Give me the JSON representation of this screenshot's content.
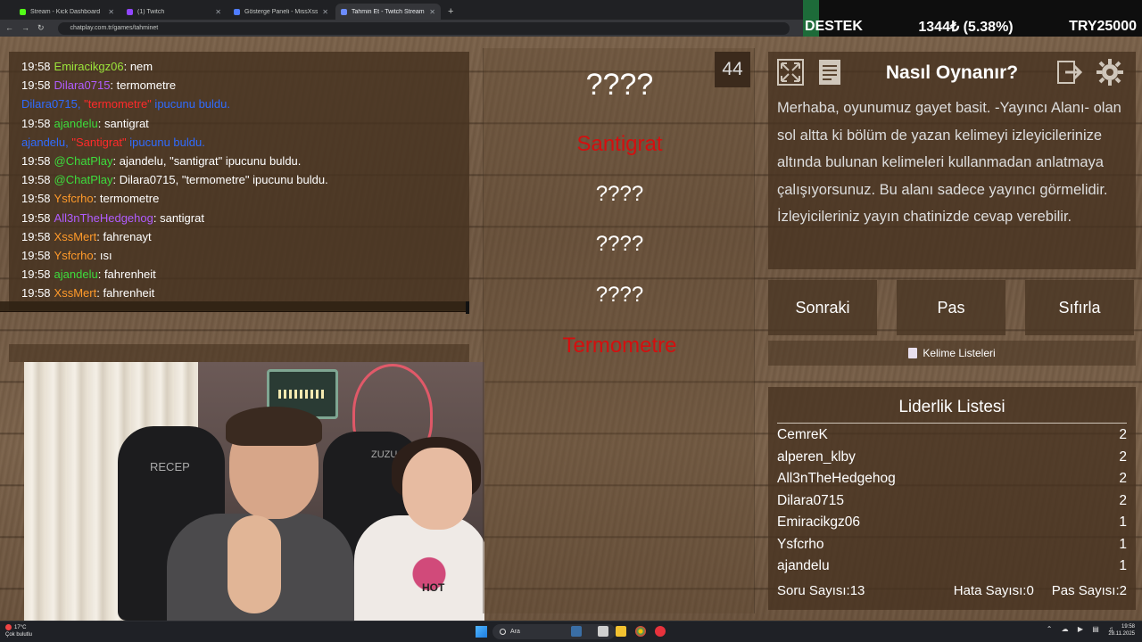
{
  "browser": {
    "tabs": [
      {
        "title": "Stream - Kick Dashboard",
        "color": "#53fc18",
        "active": false
      },
      {
        "title": "(1) Twitch",
        "color": "#9146ff",
        "active": false
      },
      {
        "title": "Gösterge Paneli - MissXss AI Bot",
        "color": "#4f7cff",
        "active": false
      },
      {
        "title": "Tahmin Et - Twitch Stream Game",
        "color": "#6c8cff",
        "active": true
      }
    ],
    "url": "chatplay.com.tr/games/tahminet"
  },
  "ticker": {
    "symbol": "DESTEK",
    "value": "1344₺ (5.38%)",
    "goal": "TRY25000"
  },
  "chat": {
    "lines": [
      {
        "time": "19:58",
        "user": "Emiracikgz06",
        "user_color": "#9be43b",
        "sep": ": ",
        "msg": "nem",
        "msg_color": "#ffffff",
        "system": false
      },
      {
        "time": "19:58",
        "user": "Dilara0715",
        "user_color": "#b05cff",
        "sep": ": ",
        "msg": "termometre",
        "msg_color": "#ffffff",
        "system": false
      },
      {
        "time": "",
        "user": "Dilara0715, ",
        "user_color": "#2f6bff",
        "sep": "",
        "msg": "\"termometre\"",
        "msg_color": "#ff2a2a",
        "tail": " ipucunu buldu.",
        "system": true
      },
      {
        "time": "19:58",
        "user": "ajandelu",
        "user_color": "#3ddc3d",
        "sep": ": ",
        "msg": "santigrat",
        "msg_color": "#ffffff",
        "system": false
      },
      {
        "time": "",
        "user": "ajandelu, ",
        "user_color": "#2f6bff",
        "sep": "",
        "msg": "\"Santigrat\"",
        "msg_color": "#ff2a2a",
        "tail": " ipucunu buldu.",
        "system": true
      },
      {
        "time": "19:58",
        "user": "@ChatPlay",
        "user_color": "#3ddc3d",
        "sep": ": ",
        "msg": "ajandelu, \"santigrat\" ipucunu buldu.",
        "msg_color": "#ffffff",
        "system": false
      },
      {
        "time": "19:58",
        "user": "@ChatPlay",
        "user_color": "#3ddc3d",
        "sep": ": ",
        "msg": "Dilara0715, \"termometre\" ipucunu buldu.",
        "msg_color": "#ffffff",
        "system": false
      },
      {
        "time": "19:58",
        "user": "Ysfcrho",
        "user_color": "#ff9a2a",
        "sep": ": ",
        "msg": "termometre",
        "msg_color": "#ffffff",
        "system": false
      },
      {
        "time": "19:58",
        "user": "All3nTheHedgehog",
        "user_color": "#b05cff",
        "sep": ": ",
        "msg": "santigrat",
        "msg_color": "#ffffff",
        "system": false
      },
      {
        "time": "19:58",
        "user": "XssMert",
        "user_color": "#ff9a2a",
        "sep": ": ",
        "msg": "fahrenayt",
        "msg_color": "#ffffff",
        "system": false
      },
      {
        "time": "19:58",
        "user": "Ysfcrho",
        "user_color": "#ff9a2a",
        "sep": ": ",
        "msg": "ısı",
        "msg_color": "#ffffff",
        "system": false
      },
      {
        "time": "19:58",
        "user": "ajandelu",
        "user_color": "#3ddc3d",
        "sep": ": ",
        "msg": "fahrenheit",
        "msg_color": "#ffffff",
        "system": false
      },
      {
        "time": "19:58",
        "user": "XssMert",
        "user_color": "#ff9a2a",
        "sep": ": ",
        "msg": "fahrenheit",
        "msg_color": "#ffffff",
        "system": false
      }
    ]
  },
  "webcam": {
    "chair_left_text": "RECEP",
    "chair_right_text": "ZUZU",
    "shirt_text": "HOT"
  },
  "game": {
    "counter": "44",
    "main_word": "????",
    "hints": [
      {
        "text": "Santigrat",
        "found": true
      },
      {
        "text": "????",
        "found": false
      },
      {
        "text": "????",
        "found": false
      },
      {
        "text": "????",
        "found": false
      },
      {
        "text": "Termometre",
        "found": true
      }
    ]
  },
  "info": {
    "title": "Nasıl Oynanır?",
    "text": "Merhaba, oyunumuz gayet basit. -Yayıncı Alanı- olan sol altta ki bölüm de yazan kelimeyi izleyicilerinize altında bulunan kelimeleri kullanmadan anlatmaya çalışıyorsunuz. Bu alanı sadece yayıncı görmelidir. İzleyicileriniz yayın chatinizde cevap verebilir."
  },
  "actions": {
    "next": "Sonraki",
    "pass": "Pas",
    "reset": "Sıfırla",
    "word_lists": "Kelime Listeleri"
  },
  "leaderboard": {
    "title": "Liderlik Listesi",
    "rows": [
      {
        "name": "CemreK",
        "score": "2"
      },
      {
        "name": "alperen_klby",
        "score": "2"
      },
      {
        "name": "All3nTheHedgehog",
        "score": "2"
      },
      {
        "name": "Dilara0715",
        "score": "2"
      },
      {
        "name": "Emiracikgz06",
        "score": "1"
      },
      {
        "name": "Ysfcrho",
        "score": "1"
      },
      {
        "name": "ajandelu",
        "score": "1"
      }
    ],
    "questions_label": "Soru Sayısı:",
    "questions": "13",
    "errors_label": "Hata Sayısı:",
    "errors": "0",
    "passes_label": "Pas Sayısı:",
    "passes": "2"
  },
  "taskbar": {
    "temp": "17°C",
    "weather": "Çok bulutlu",
    "search": "Ara",
    "time": "19:58",
    "date": "28.11.2025"
  }
}
